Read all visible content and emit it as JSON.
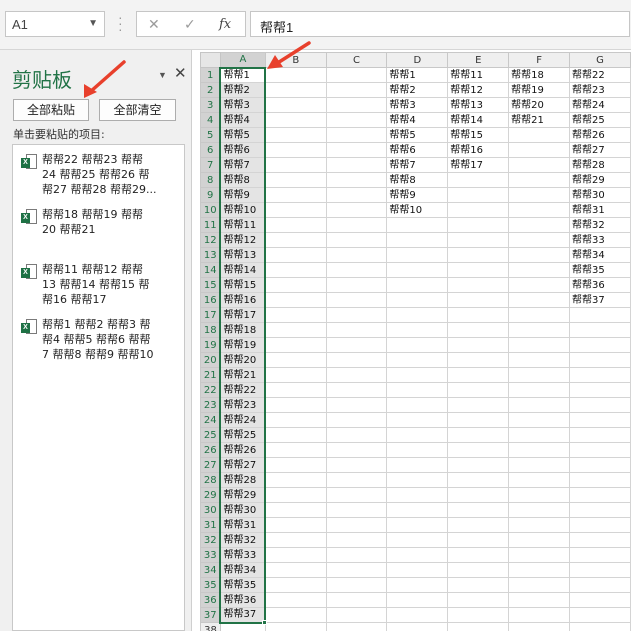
{
  "formula_bar": {
    "name_box": "A1",
    "cancel_glyph": "✕",
    "enter_glyph": "✓",
    "fx_label": "fx",
    "formula_value": "帮帮1"
  },
  "clipboard_pane": {
    "title": "剪贴板",
    "paste_all": "全部粘贴",
    "clear_all": "全部清空",
    "hint": "单击要粘贴的项目:",
    "items": [
      "帮帮22 帮帮23 帮帮\n24 帮帮25 帮帮26 帮\n帮27 帮帮28 帮帮29...",
      "帮帮18 帮帮19 帮帮\n20 帮帮21",
      "帮帮11 帮帮12 帮帮\n13 帮帮14 帮帮15 帮\n帮16 帮帮17",
      "帮帮1 帮帮2 帮帮3 帮\n帮4 帮帮5 帮帮6 帮帮\n7 帮帮8 帮帮9 帮帮10"
    ]
  },
  "sheet": {
    "columns": [
      "A",
      "B",
      "C",
      "D",
      "E",
      "F",
      "G"
    ],
    "selected_column": "A",
    "rows": [
      {
        "n": "1",
        "A": "帮帮1",
        "D": "帮帮1",
        "E": "帮帮11",
        "F": "帮帮18",
        "G": "帮帮22"
      },
      {
        "n": "2",
        "A": "帮帮2",
        "D": "帮帮2",
        "E": "帮帮12",
        "F": "帮帮19",
        "G": "帮帮23"
      },
      {
        "n": "3",
        "A": "帮帮3",
        "D": "帮帮3",
        "E": "帮帮13",
        "F": "帮帮20",
        "G": "帮帮24"
      },
      {
        "n": "4",
        "A": "帮帮4",
        "D": "帮帮4",
        "E": "帮帮14",
        "F": "帮帮21",
        "G": "帮帮25"
      },
      {
        "n": "5",
        "A": "帮帮5",
        "D": "帮帮5",
        "E": "帮帮15",
        "G": "帮帮26"
      },
      {
        "n": "6",
        "A": "帮帮6",
        "D": "帮帮6",
        "E": "帮帮16",
        "G": "帮帮27"
      },
      {
        "n": "7",
        "A": "帮帮7",
        "D": "帮帮7",
        "E": "帮帮17",
        "G": "帮帮28"
      },
      {
        "n": "8",
        "A": "帮帮8",
        "D": "帮帮8",
        "G": "帮帮29"
      },
      {
        "n": "9",
        "A": "帮帮9",
        "D": "帮帮9",
        "G": "帮帮30"
      },
      {
        "n": "10",
        "A": "帮帮10",
        "D": "帮帮10",
        "G": "帮帮31"
      },
      {
        "n": "11",
        "A": "帮帮11",
        "G": "帮帮32"
      },
      {
        "n": "12",
        "A": "帮帮12",
        "G": "帮帮33"
      },
      {
        "n": "13",
        "A": "帮帮13",
        "G": "帮帮34"
      },
      {
        "n": "14",
        "A": "帮帮14",
        "G": "帮帮35"
      },
      {
        "n": "15",
        "A": "帮帮15",
        "G": "帮帮36"
      },
      {
        "n": "16",
        "A": "帮帮16",
        "G": "帮帮37"
      },
      {
        "n": "17",
        "A": "帮帮17"
      },
      {
        "n": "18",
        "A": "帮帮18"
      },
      {
        "n": "19",
        "A": "帮帮19"
      },
      {
        "n": "20",
        "A": "帮帮20"
      },
      {
        "n": "21",
        "A": "帮帮21"
      },
      {
        "n": "22",
        "A": "帮帮22"
      },
      {
        "n": "23",
        "A": "帮帮23"
      },
      {
        "n": "24",
        "A": "帮帮24"
      },
      {
        "n": "25",
        "A": "帮帮25"
      },
      {
        "n": "26",
        "A": "帮帮26"
      },
      {
        "n": "27",
        "A": "帮帮27"
      },
      {
        "n": "28",
        "A": "帮帮28"
      },
      {
        "n": "29",
        "A": "帮帮29"
      },
      {
        "n": "30",
        "A": "帮帮30"
      },
      {
        "n": "31",
        "A": "帮帮31"
      },
      {
        "n": "32",
        "A": "帮帮32"
      },
      {
        "n": "33",
        "A": "帮帮33"
      },
      {
        "n": "34",
        "A": "帮帮34"
      },
      {
        "n": "35",
        "A": "帮帮35"
      },
      {
        "n": "36",
        "A": "帮帮36"
      },
      {
        "n": "37",
        "A": "帮帮37"
      },
      {
        "n": "38"
      }
    ]
  },
  "colors": {
    "excel_green": "#217346",
    "annotation_red": "#e8402c"
  },
  "icons": {
    "clip_item_icon": "excel-file-icon",
    "pane_menu": "dropdown-triangle-icon",
    "pane_close": "close-icon"
  }
}
